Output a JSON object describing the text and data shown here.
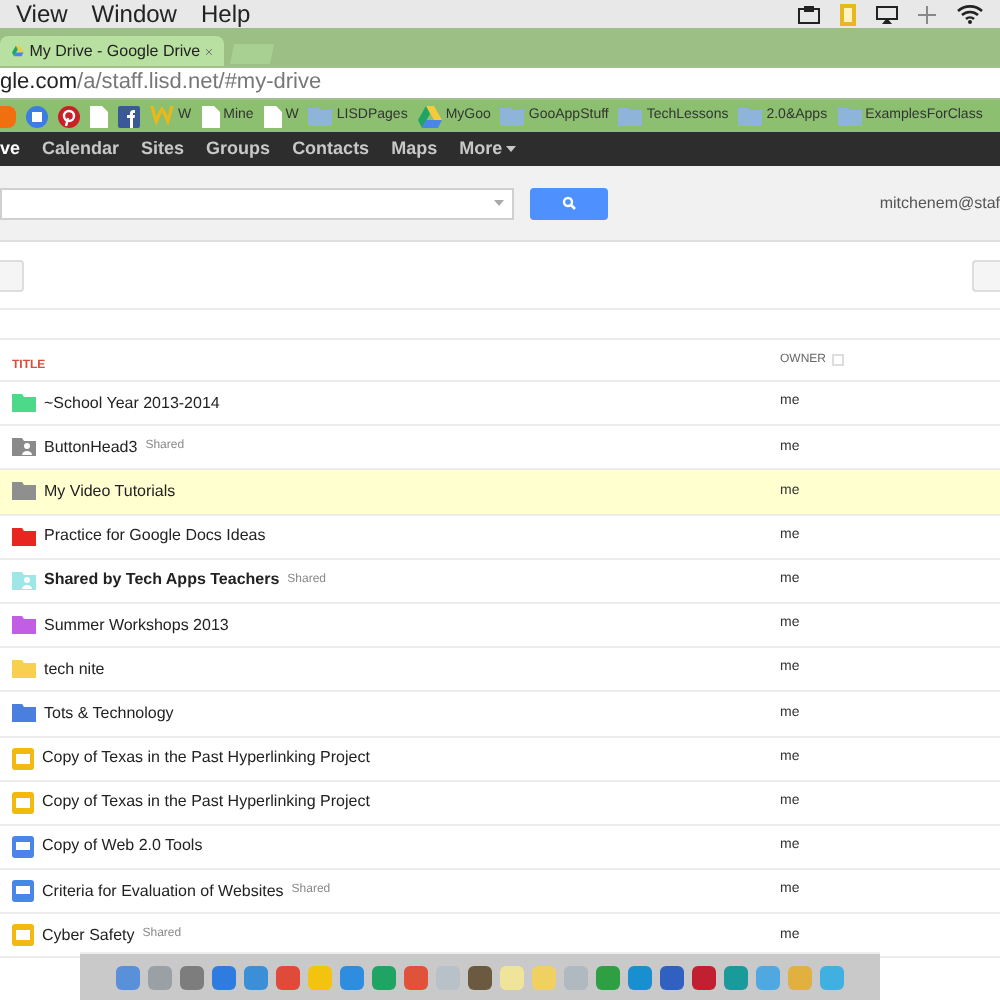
{
  "menu_bar": {
    "items": [
      "View",
      "Window",
      "Help"
    ]
  },
  "browser": {
    "tab": {
      "title": "My Drive - Google Drive"
    },
    "url": {
      "host": "gle.com",
      "path": "/a/staff.lisd.net/#my-drive"
    },
    "bookmarks": [
      {
        "kind": "orange"
      },
      {
        "kind": "calendar"
      },
      {
        "kind": "pinterest"
      },
      {
        "kind": "page"
      },
      {
        "kind": "facebook"
      },
      {
        "kind": "w",
        "label": "W"
      },
      {
        "kind": "page",
        "label": "Mine"
      },
      {
        "kind": "page",
        "label": "W"
      },
      {
        "kind": "folder",
        "label": "LISDPages"
      },
      {
        "kind": "drive",
        "label": "MyGoo"
      },
      {
        "kind": "folder",
        "label": "GooAppStuff"
      },
      {
        "kind": "folder",
        "label": "TechLessons"
      },
      {
        "kind": "folder",
        "label": "2.0&Apps"
      },
      {
        "kind": "folder",
        "label": "ExamplesForClass"
      }
    ]
  },
  "google_bar": {
    "items": [
      {
        "label": "ve",
        "selected": true,
        "menu": false
      },
      {
        "label": "Calendar",
        "selected": false,
        "menu": false
      },
      {
        "label": "Sites",
        "selected": false,
        "menu": false
      },
      {
        "label": "Groups",
        "selected": false,
        "menu": false
      },
      {
        "label": "Contacts",
        "selected": false,
        "menu": false
      },
      {
        "label": "Maps",
        "selected": false,
        "menu": false
      },
      {
        "label": "More",
        "selected": false,
        "menu": true
      }
    ]
  },
  "header": {
    "account": "mitchenem@staf"
  },
  "file_list": {
    "columns": [
      {
        "label": "TITLE",
        "sorted": true
      },
      {
        "label": "OWNER",
        "sorted": false
      }
    ],
    "rows": [
      {
        "kind": "folder",
        "color": "#4cd98a",
        "title": "~School Year 2013-2014",
        "owner": "me",
        "bold": false,
        "selected": false
      },
      {
        "kind": "shared-folder",
        "color": "#8a8a8a",
        "title": "ButtonHead3",
        "badge": "Shared",
        "owner": "me",
        "bold": false,
        "selected": false
      },
      {
        "kind": "folder",
        "color": "#8f8f8f",
        "title": "My Video Tutorials",
        "owner": "me",
        "bold": false,
        "selected": true
      },
      {
        "kind": "folder",
        "color": "#e8261f",
        "title": "Practice for Google Docs Ideas",
        "owner": "me",
        "bold": false,
        "selected": false
      },
      {
        "kind": "shared-folder",
        "color": "#9fe6e6",
        "title": "Shared by Tech Apps Teachers",
        "badge": "Shared",
        "owner": "me",
        "bold": true,
        "selected": false
      },
      {
        "kind": "folder",
        "color": "#c25ee6",
        "title": "Summer Workshops 2013",
        "owner": "me",
        "bold": false,
        "selected": false
      },
      {
        "kind": "folder",
        "color": "#f7d04f",
        "title": "tech nite",
        "owner": "me",
        "bold": false,
        "selected": false
      },
      {
        "kind": "folder",
        "color": "#4a7fe0",
        "title": "Tots & Technology",
        "owner": "me",
        "bold": false,
        "selected": false
      },
      {
        "kind": "presentation",
        "color": "#f2b90f",
        "title": "Copy of Texas in the Past Hyperlinking Project",
        "owner": "me",
        "bold": false,
        "selected": false
      },
      {
        "kind": "presentation",
        "color": "#f2b90f",
        "title": "Copy of Texas in the Past Hyperlinking Project",
        "owner": "me",
        "bold": false,
        "selected": false
      },
      {
        "kind": "document",
        "color": "#4a86e8",
        "title": "Copy of Web 2.0 Tools",
        "owner": "me",
        "bold": false,
        "selected": false
      },
      {
        "kind": "document",
        "color": "#4a86e8",
        "title": "Criteria for Evaluation of Websites",
        "badge": "Shared",
        "owner": "me",
        "bold": false,
        "selected": false
      },
      {
        "kind": "presentation",
        "color": "#f2b90f",
        "title": "Cyber Safety",
        "badge": "Shared",
        "owner": "me",
        "bold": false,
        "selected": false
      }
    ]
  }
}
